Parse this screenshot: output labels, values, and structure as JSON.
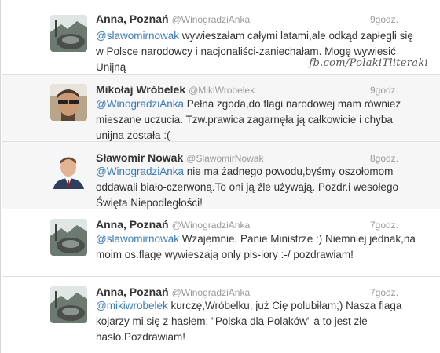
{
  "tweets": [
    {
      "fullname": "Anna, Poznań",
      "username": "@WinogradziAnka",
      "time": "9godz.",
      "mention": "@slawomirnowak",
      "text": " wywieszałam całymi latami,ale odkąd zapłegli się w Polsce narodowcy i nacjonaliści-zaniechałam. Mogę wywiesić Unijną",
      "avatar": "city-fountain-photo"
    },
    {
      "fullname": "Mikołaj Wróbelek",
      "username": "@MikiWrobelek",
      "time": "9godz.",
      "mention": "@WinogradziAnka",
      "text": " Pełna zgoda,do flagi narodowej mam również mieszane uczucia. Tzw.prawica zagarnęła ją całkowicie i chyba unijna została :(",
      "avatar": "man-with-sunglasses-photo"
    },
    {
      "fullname": "Sławomir Nowak",
      "username": "@SlawomirNowak",
      "time": "8godz.",
      "mention": "@WinogradziAnka",
      "text": " nie ma żadnego powodu,byśmy oszołomom oddawali biało-czerwoną.To oni ją źle używają. Pozdr.i wesołego Święta Niepodległości!",
      "avatar": "man-in-suit-photo"
    },
    {
      "fullname": "Anna, Poznań",
      "username": "@WinogradziAnka",
      "time": "7godz.",
      "mention": "@slawomirnowak",
      "text": " Wzajemnie, Panie Ministrze :) Niemniej jednak,na moim os.flagę wywieszają only pis-iory :-/ pozdrawiam!",
      "avatar": "city-fountain-photo"
    },
    {
      "fullname": "Anna, Poznań",
      "username": "@WinogradziAnka",
      "time": "7godz.",
      "mention": "@mikiwrobelek",
      "text": " kurczę,Wróbelku, już Cię polubiłam;) Nasza flaga kojarzy mi się z hasłem: \"Polska dla Polaków\" a to jest złe hasło.Pozdrawiam!",
      "avatar": "city-fountain-photo"
    }
  ],
  "watermark": "fb.com/PolakiTliteraki"
}
